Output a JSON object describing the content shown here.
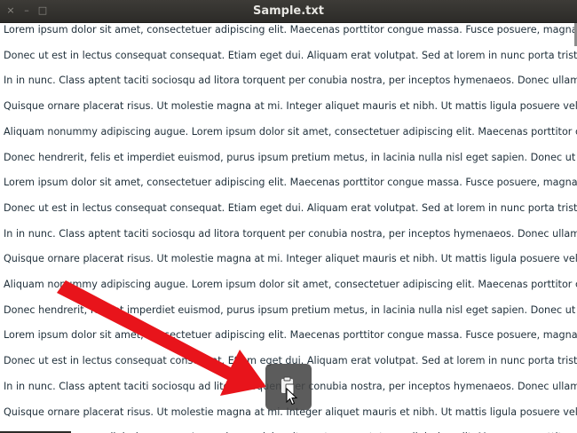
{
  "window": {
    "title": "Sample.txt",
    "controls": {
      "close": "×",
      "minimize": "–",
      "maximize": "□"
    }
  },
  "editor": {
    "lines": [
      "Lorem ipsum dolor sit amet, consectetuer adipiscing elit. Maecenas porttitor congue massa. Fusce posuere, magna s",
      "Donec ut est in lectus consequat consequat. Etiam eget dui. Aliquam erat volutpat. Sed at lorem in nunc porta tristiqu",
      "In in nunc. Class aptent taciti sociosqu ad litora torquent per conubia nostra, per inceptos hymenaeos. Donec ullamc",
      "Quisque ornare placerat risus. Ut molestie magna at mi. Integer aliquet mauris et nibh. Ut mattis ligula posuere velit.",
      "Aliquam nonummy adipiscing augue. Lorem ipsum dolor sit amet, consectetuer adipiscing elit. Maecenas porttitor co",
      "Donec hendrerit, felis et imperdiet euismod, purus ipsum pretium metus, in lacinia nulla nisl eget sapien. Donec ut e",
      "Lorem ipsum dolor sit amet, consectetuer adipiscing elit. Maecenas porttitor congue massa. Fusce posuere, magna s",
      "Donec ut est in lectus consequat consequat. Etiam eget dui. Aliquam erat volutpat. Sed at lorem in nunc porta tristiqu",
      "In in nunc. Class aptent taciti sociosqu ad litora torquent per conubia nostra, per inceptos hymenaeos. Donec ullamc",
      "Quisque ornare placerat risus. Ut molestie magna at mi. Integer aliquet mauris et nibh. Ut mattis ligula posuere velit.",
      "Aliquam nonummy adipiscing augue. Lorem ipsum dolor sit amet, consectetuer adipiscing elit. Maecenas porttitor co",
      "Donec hendrerit, felis et imperdiet euismod, purus ipsum pretium metus, in lacinia nulla nisl eget sapien. Donec ut e",
      "Lorem ipsum dolor sit amet, consectetuer adipiscing elit. Maecenas porttitor congue massa. Fusce posuere, magna s",
      "Donec ut est in lectus consequat consequat. Etiam eget dui. Aliquam erat volutpat. Sed at lorem in nunc porta tristiqu",
      "In in nunc. Class aptent taciti sociosqu ad litora torquent per conubia nostra, per inceptos hymenaeos. Donec ullamc",
      "Quisque ornare placerat risus. Ut molestie magna at mi. Integer aliquet mauris et nibh. Ut mattis ligula posuere velit.",
      "Aliquam nonummy adipiscing augue. Lorem ipsum dolor sit amet, consectetuer adipiscing elit. Maecenas porttitor co"
    ]
  },
  "overlay": {
    "paste_button_icon": "paste-icon",
    "cursor_icon": "mouse-pointer-icon",
    "annotation_arrow_color": "#e8141b"
  },
  "colors": {
    "titlebar": "#2c2b28",
    "title_text": "#e7e6e2",
    "text": "#1f2f3a",
    "paste_button_bg": "#464646"
  }
}
